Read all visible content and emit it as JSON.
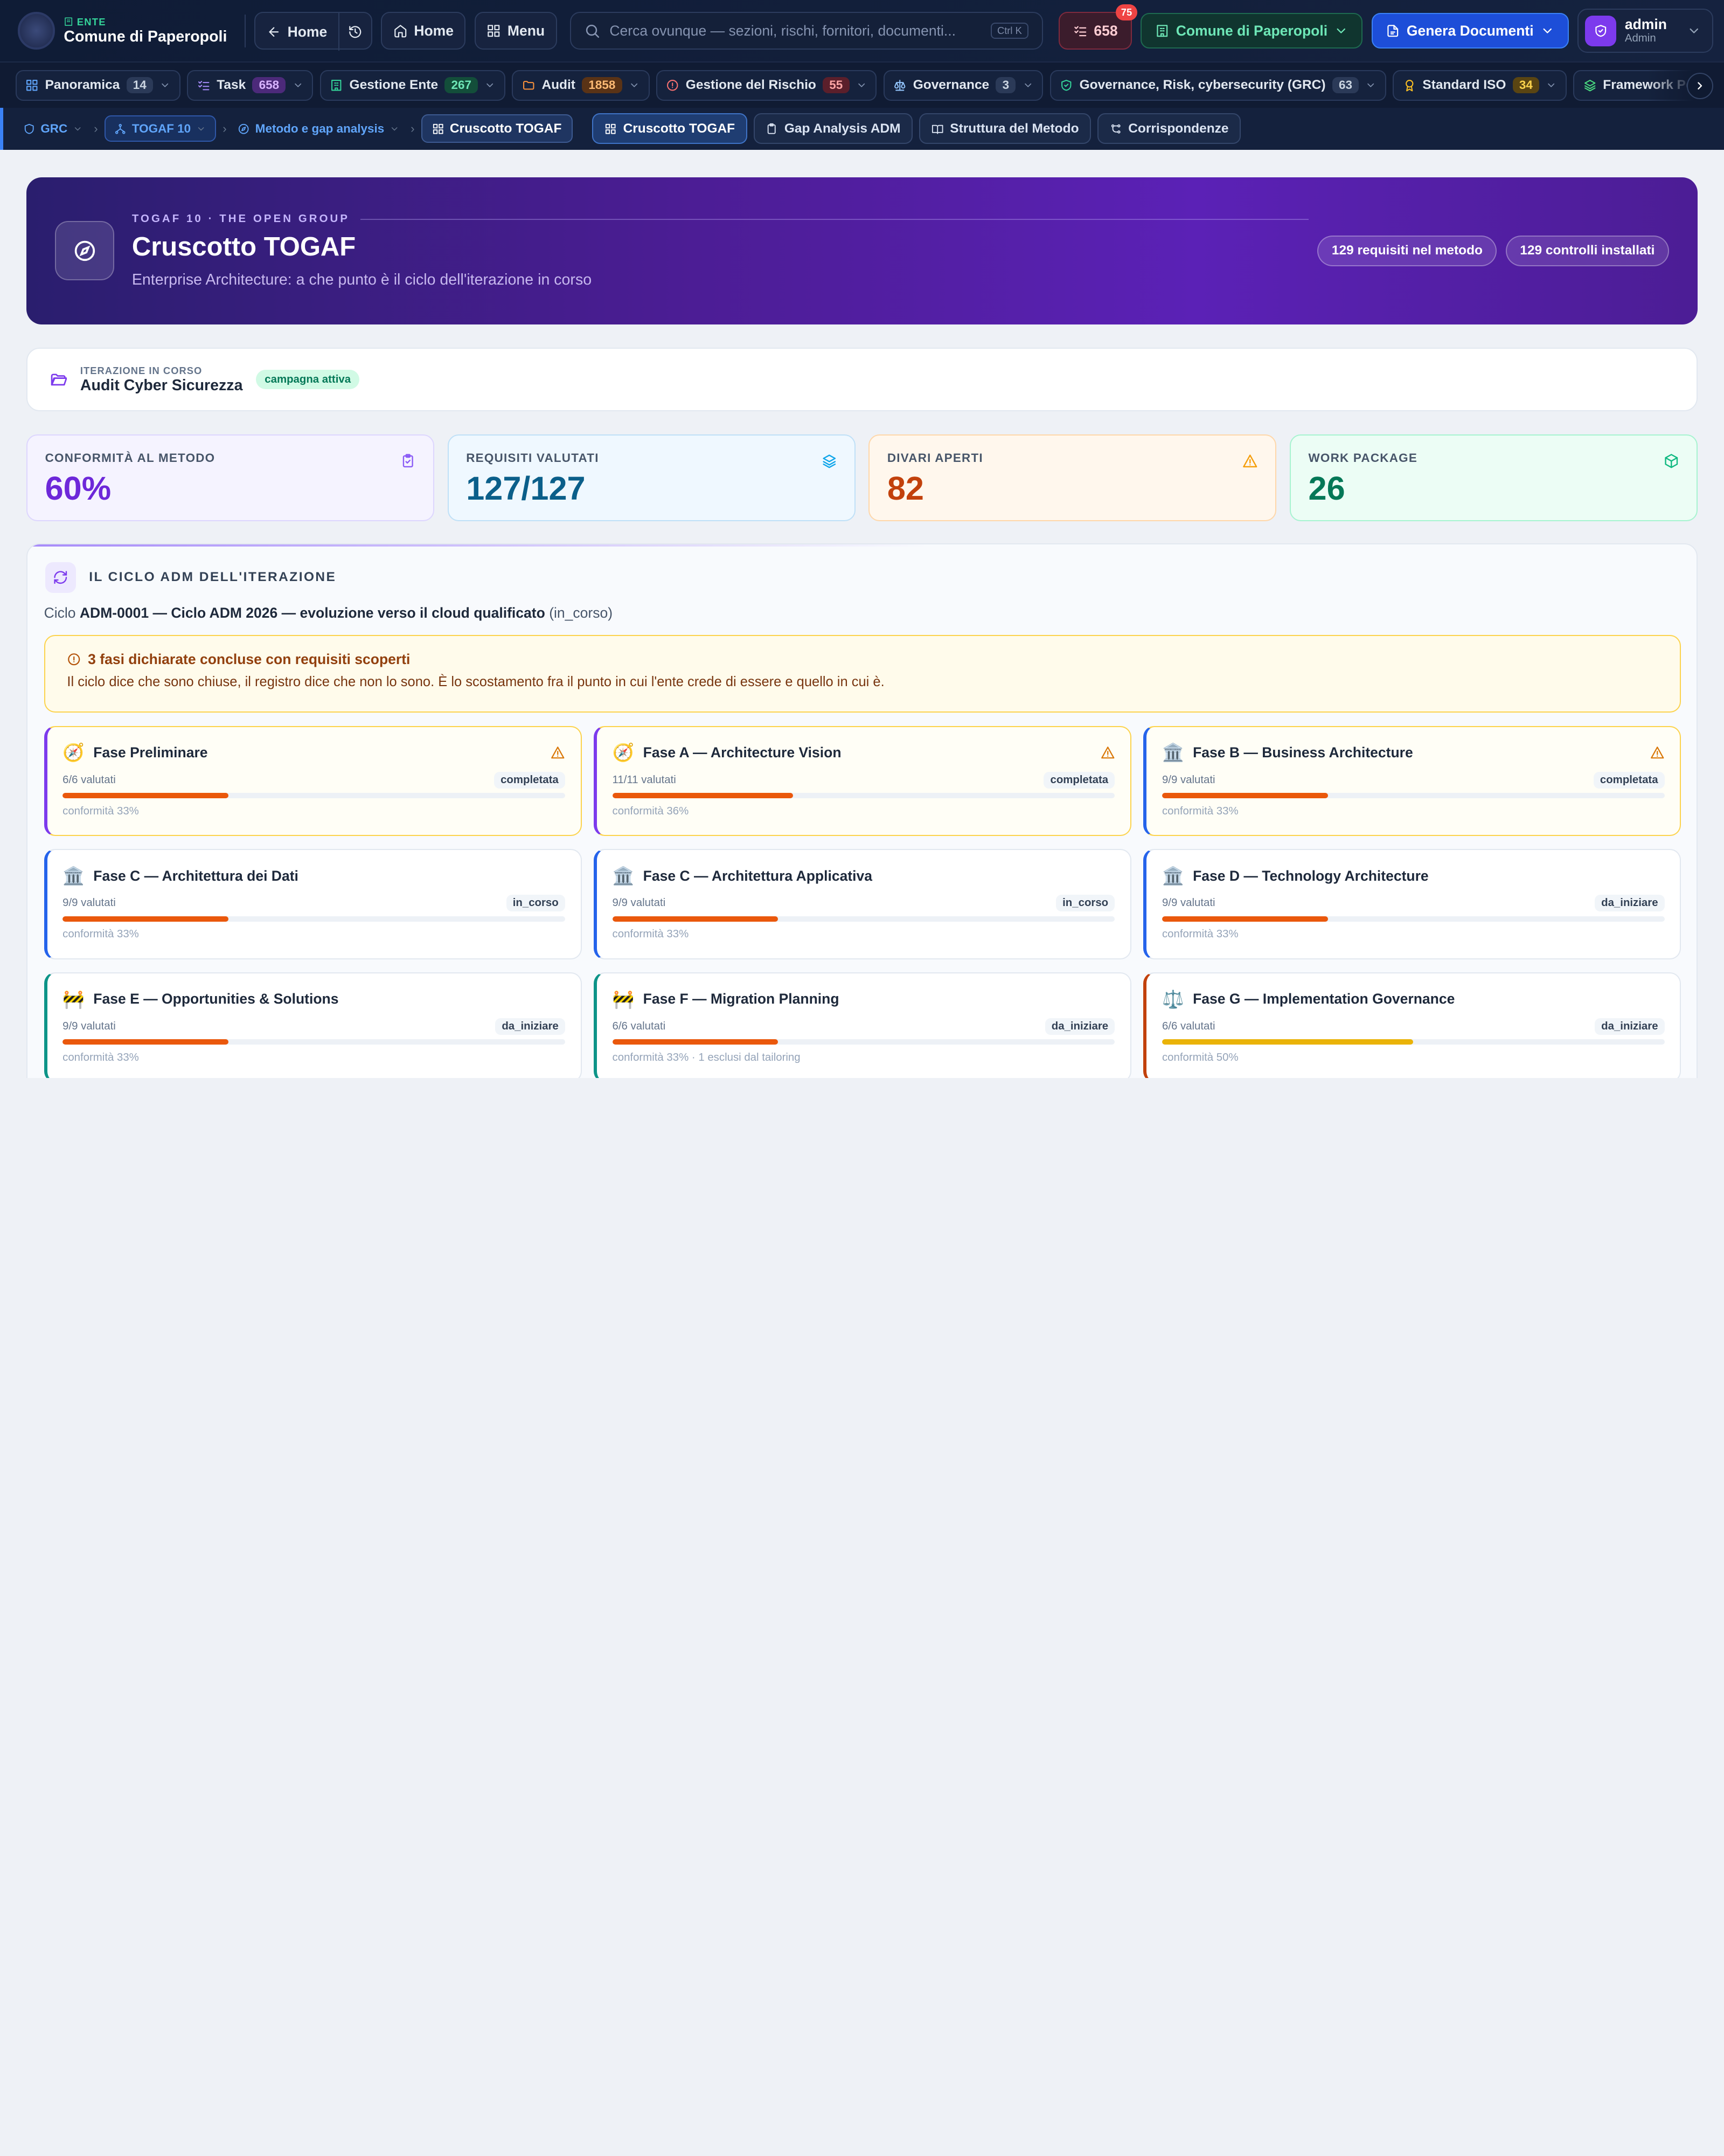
{
  "topbar": {
    "ente_tag": "ENTE",
    "ente_name": "Comune di Paperopoli",
    "back_label": "Home",
    "home_label": "Home",
    "menu_label": "Menu",
    "search_placeholder": "Cerca ovunque — sezioni, rischi, fornitori, documenti...",
    "search_shortcut": "Ctrl K",
    "task_count": "658",
    "task_badge": "75",
    "comune_label": "Comune di Paperopoli",
    "genera_label": "Genera Documenti",
    "user_name": "admin",
    "user_role": "Admin"
  },
  "modules": [
    {
      "label": "Panoramica",
      "count": "14",
      "icon": "grid-icon",
      "color": "#60a5fa",
      "badge_bg": "#2b3a58",
      "badge_fg": "#cbd5e1"
    },
    {
      "label": "Task",
      "count": "658",
      "icon": "list-check-icon",
      "color": "#a78bfa",
      "badge_bg": "#4c2a7a",
      "badge_fg": "#d8b4fe"
    },
    {
      "label": "Gestione Ente",
      "count": "267",
      "icon": "building-icon",
      "color": "#34d399",
      "badge_bg": "#134e3a",
      "badge_fg": "#6ee7b7"
    },
    {
      "label": "Audit",
      "count": "1858",
      "icon": "folder-icon",
      "color": "#fb923c",
      "badge_bg": "#5a3316",
      "badge_fg": "#fdba74"
    },
    {
      "label": "Gestione del Rischio",
      "count": "55",
      "icon": "alert-circle-icon",
      "color": "#f87171",
      "badge_bg": "#5b1f2b",
      "badge_fg": "#fca5a5"
    },
    {
      "label": "Governance",
      "count": "3",
      "icon": "scale-icon",
      "color": "#93c5fd",
      "badge_bg": "#2b3a58",
      "badge_fg": "#cbd5e1"
    },
    {
      "label": "Governance, Risk, cybersecurity (GRC)",
      "count": "63",
      "icon": "shield-icon",
      "color": "#34d399",
      "badge_bg": "#2b3a58",
      "badge_fg": "#cbd5e1"
    },
    {
      "label": "Standard ISO",
      "count": "34",
      "icon": "award-icon",
      "color": "#fbbf24",
      "badge_bg": "#5a4512",
      "badge_fg": "#fcd34d"
    },
    {
      "label": "Framework Personalizzati",
      "count": "",
      "icon": "layers-icon",
      "color": "#4ade80",
      "badge_bg": "",
      "badge_fg": ""
    }
  ],
  "breadcrumb": {
    "grc": "GRC",
    "togaf": "TOGAF 10",
    "metodo": "Metodo e gap analysis",
    "current": "Cruscotto TOGAF"
  },
  "view_tabs": [
    {
      "label": "Cruscotto TOGAF",
      "icon": "grid-icon",
      "active": true
    },
    {
      "label": "Gap Analysis ADM",
      "icon": "clipboard-icon",
      "active": false
    },
    {
      "label": "Struttura del Metodo",
      "icon": "book-icon",
      "active": false
    },
    {
      "label": "Corrispondenze",
      "icon": "link-icon",
      "active": false
    }
  ],
  "hero": {
    "eyebrow": "TOGAF 10 · THE OPEN GROUP",
    "title": "Cruscotto TOGAF",
    "subtitle": "Enterprise Architecture: a che punto è il ciclo dell'iterazione in corso",
    "pill_requisiti": "129 requisiti nel metodo",
    "pill_controlli": "129 controlli installati"
  },
  "iteration": {
    "label": "ITERAZIONE IN CORSO",
    "name": "Audit Cyber Sicurezza",
    "badge": "campagna attiva"
  },
  "stats": [
    {
      "label": "CONFORMITÀ AL METODO",
      "value": "60%",
      "icon": "clipboard-check-icon",
      "bg": "#f5f3ff",
      "border": "#ddd6fe",
      "fg": "#6d28d9",
      "iconColor": "#8b5cf6"
    },
    {
      "label": "REQUISITI VALUTATI",
      "value": "127/127",
      "icon": "layers-icon",
      "bg": "#eff8ff",
      "border": "#bfe0f7",
      "fg": "#0b5f8a",
      "iconColor": "#0ea5e9"
    },
    {
      "label": "DIVARI APERTI",
      "value": "82",
      "icon": "alert-triangle-icon",
      "bg": "#fff7ed",
      "border": "#fed7aa",
      "fg": "#c2410c",
      "iconColor": "#f59e0b"
    },
    {
      "label": "WORK PACKAGE",
      "value": "26",
      "icon": "package-icon",
      "bg": "#ecfdf5",
      "border": "#a7f3d0",
      "fg": "#047857",
      "iconColor": "#10b981"
    }
  ],
  "adm": {
    "title": "IL CICLO ADM DELL'ITERAZIONE",
    "cycle_prefix": "Ciclo",
    "cycle_name": "ADM-0001 — Ciclo ADM 2026 — evoluzione verso il cloud qualificato",
    "cycle_status": "(in_corso)",
    "warning_title": "3 fasi dichiarate concluse con requisiti scoperti",
    "warning_text": "Il ciclo dice che sono chiuse, il registro dice che non lo sono. È lo scostamento fra il punto in cui l'ente crede di essere e quello in cui è.",
    "phases": [
      {
        "emoji": "🧭",
        "name": "Fase Preliminare",
        "valutati": "6/6 valutati",
        "status": "completata",
        "conf": "conformità 33%",
        "pct": 0.33,
        "warn": true,
        "accent": "#7c3aed",
        "bar": "#ea580c"
      },
      {
        "emoji": "🧭",
        "name": "Fase A — Architecture Vision",
        "valutati": "11/11 valutati",
        "status": "completata",
        "conf": "conformità 36%",
        "pct": 0.36,
        "warn": true,
        "accent": "#7c3aed",
        "bar": "#ea580c"
      },
      {
        "emoji": "🏛️",
        "name": "Fase B — Business Architecture",
        "valutati": "9/9 valutati",
        "status": "completata",
        "conf": "conformità 33%",
        "pct": 0.33,
        "warn": true,
        "accent": "#2563eb",
        "bar": "#ea580c"
      },
      {
        "emoji": "🏛️",
        "name": "Fase C — Architettura dei Dati",
        "valutati": "9/9 valutati",
        "status": "in_corso",
        "conf": "conformità 33%",
        "pct": 0.33,
        "warn": false,
        "accent": "#2563eb",
        "bar": "#ea580c"
      },
      {
        "emoji": "🏛️",
        "name": "Fase C — Architettura Applicativa",
        "valutati": "9/9 valutati",
        "status": "in_corso",
        "conf": "conformità 33%",
        "pct": 0.33,
        "warn": false,
        "accent": "#2563eb",
        "bar": "#ea580c"
      },
      {
        "emoji": "🏛️",
        "name": "Fase D — Technology Architecture",
        "valutati": "9/9 valutati",
        "status": "da_iniziare",
        "conf": "conformità 33%",
        "pct": 0.33,
        "warn": false,
        "accent": "#2563eb",
        "bar": "#ea580c"
      },
      {
        "emoji": "🚧",
        "name": "Fase E — Opportunities & Solutions",
        "valutati": "9/9 valutati",
        "status": "da_iniziare",
        "conf": "conformità 33%",
        "pct": 0.33,
        "warn": false,
        "accent": "#0d9488",
        "bar": "#ea580c"
      },
      {
        "emoji": "🚧",
        "name": "Fase F — Migration Planning",
        "valutati": "6/6 valutati",
        "status": "da_iniziare",
        "conf": "conformità 33% · 1 esclusi dal tailoring",
        "pct": 0.33,
        "warn": false,
        "accent": "#0d9488",
        "bar": "#ea580c"
      },
      {
        "emoji": "⚖️",
        "name": "Fase G — Implementation Governance",
        "valutati": "6/6 valutati",
        "status": "da_iniziare",
        "conf": "conformità 50%",
        "pct": 0.5,
        "warn": false,
        "accent": "#c2410c",
        "bar": "#eab308"
      }
    ]
  }
}
